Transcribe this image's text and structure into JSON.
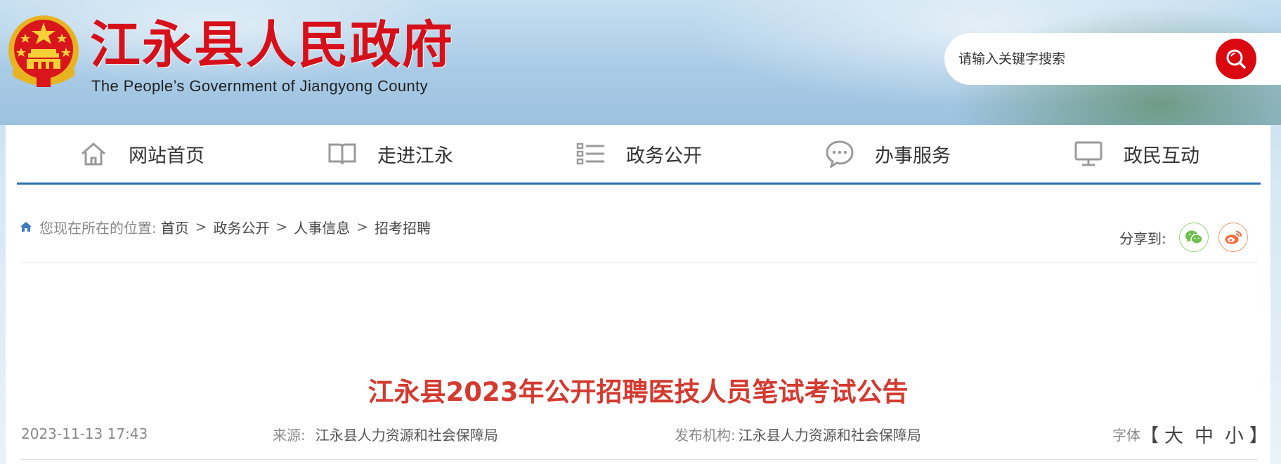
{
  "header": {
    "site_title": "江永县人民政府",
    "site_subtitle": "The People’s Government of Jiangyong County",
    "emblem_icon": "national-emblem-icon",
    "search": {
      "placeholder": "请输入关键字搜索",
      "button_icon": "search-icon"
    },
    "accent_color": "#d6101a"
  },
  "nav": {
    "items": [
      {
        "label": "网站首页",
        "icon": "home-icon"
      },
      {
        "label": "走进江永",
        "icon": "book-icon"
      },
      {
        "label": "政务公开",
        "icon": "list-icon"
      },
      {
        "label": "办事服务",
        "icon": "chat-icon"
      },
      {
        "label": "政民互动",
        "icon": "monitor-icon"
      }
    ],
    "underline_color": "#2a6fb0"
  },
  "breadcrumb": {
    "prefix": "您现在所在的位置:",
    "items": [
      "首页",
      "政务公开",
      "人事信息",
      "招考招聘"
    ],
    "separator": ">"
  },
  "share": {
    "label": "分享到:",
    "targets": [
      "wechat-icon",
      "weibo-icon"
    ]
  },
  "article": {
    "title": "江永县2023年公开招聘医技人员笔试考试公告",
    "date": "2023-11-13 17:43",
    "source_label": "来源:",
    "source_value": "江永县人力资源和社会保障局",
    "org_label": "发布机构:",
    "org_value": "江永县人力资源和社会保障局",
    "font_label": "字体",
    "font_sizes": [
      "大",
      "中",
      "小"
    ],
    "title_color": "#d43a2f"
  }
}
